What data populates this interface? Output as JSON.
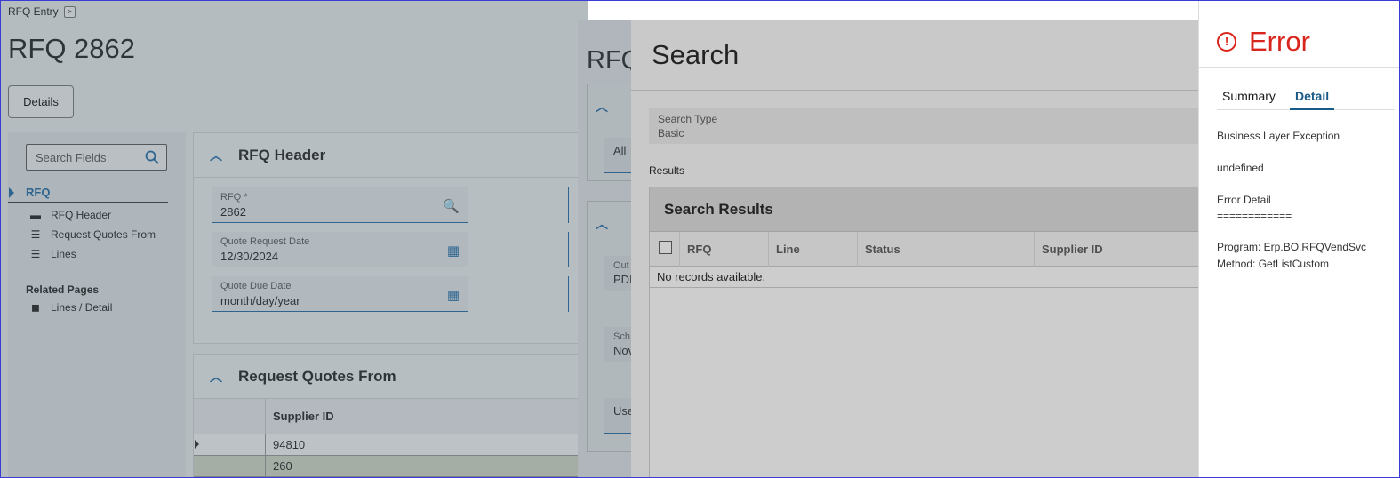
{
  "base": {
    "breadcrumb": "RFQ Entry",
    "breadcrumb_arrow": ">",
    "title": "RFQ 2862",
    "details_button": "Details",
    "search_fields_placeholder": "Search Fields",
    "nav": {
      "active": "RFQ",
      "items": [
        "RFQ Header",
        "Request Quotes From",
        "Lines"
      ],
      "related_title": "Related Pages",
      "related_items": [
        "Lines / Detail"
      ]
    },
    "rfq_header": {
      "title": "RFQ Header",
      "fields": [
        {
          "label": "RFQ *",
          "value": "2862"
        },
        {
          "label": "Quote Request Date",
          "value": "12/30/2024"
        },
        {
          "label": "Quote Due Date",
          "value": "month/day/year"
        }
      ]
    },
    "request_quotes_from": {
      "title": "Request Quotes From",
      "column": "Supplier ID",
      "rows": [
        "94810",
        "260"
      ]
    }
  },
  "middle": {
    "title": "RFQ",
    "fields": [
      {
        "label": "",
        "value": "All"
      },
      {
        "label": "Out",
        "value": "PDI"
      },
      {
        "label": "Sch",
        "value": "Nov"
      },
      {
        "label": "",
        "value": "Use"
      }
    ]
  },
  "search": {
    "title": "Search",
    "search_type_label": "Search Type",
    "search_type_value": "Basic",
    "results_label": "Results",
    "results_title": "Search Results",
    "columns": [
      "RFQ",
      "Line",
      "Status",
      "Supplier ID"
    ],
    "empty_message": "No records available."
  },
  "error": {
    "title": "Error",
    "tabs": [
      "Summary",
      "Detail"
    ],
    "active_tab": "Detail",
    "lines": [
      "Business Layer Exception",
      "undefined",
      "Error Detail",
      "============",
      "Program: Erp.BO.RFQVendSvc",
      "Method: GetListCustom"
    ]
  },
  "colors": {
    "accent": "#1a6aa8",
    "error": "#d9261c",
    "selected_row": "#d8dfc8"
  }
}
